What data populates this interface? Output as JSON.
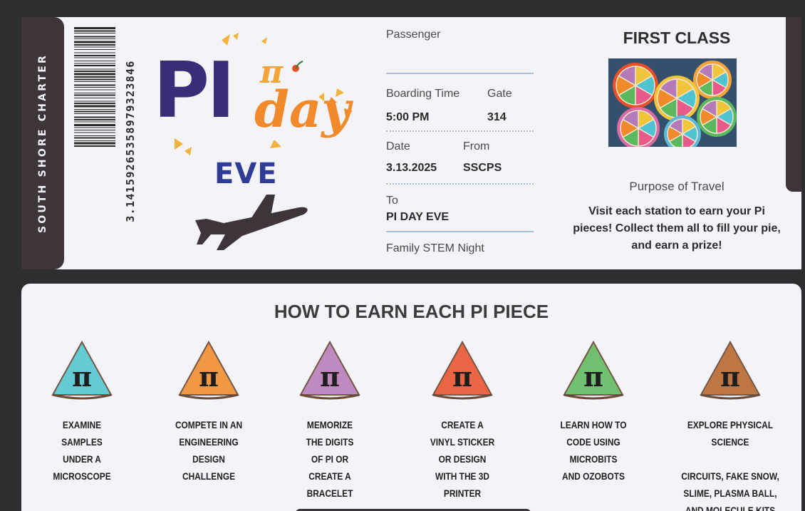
{
  "ticket": {
    "airline": "SOUTH SHORE CHARTER",
    "barcode_number": "3.14159265358979323846",
    "logo": {
      "pi": "PI",
      "pi_symbol": "π",
      "day": "day",
      "eve": "EVE"
    },
    "fields": {
      "passenger_label": "Passenger",
      "boarding_time_label": "Boarding Time",
      "boarding_time": "5:00 PM",
      "gate_label": "Gate",
      "gate": "314",
      "date_label": "Date",
      "date": "3.13.2025",
      "from_label": "From",
      "from": "SSCPS",
      "to_label": "To",
      "to": "PI DAY EVE",
      "event": "Family STEM Night"
    },
    "class": "FIRST CLASS",
    "purpose_label": "Purpose of Travel",
    "purpose_text": "Visit each station to earn your Pi pieces! Collect them all to fill your pie, and earn a prize!"
  },
  "stations_panel": {
    "title": "HOW TO EARN EACH PI PIECE",
    "stations": [
      {
        "icon": "pi-piece-blue-icon",
        "color": "#4fc3cf",
        "text": "EXAMINE\nSAMPLES\nUNDER A\nMICROSCOPE"
      },
      {
        "icon": "pi-piece-orange-icon",
        "color": "#f08a2a",
        "text": "COMPETE IN AN\nENGINEERING\nDESIGN\nCHALLENGE"
      },
      {
        "icon": "pi-piece-purple-icon",
        "color": "#b57ab8",
        "text": "MEMORIZE\nTHE DIGITS\nOF PI OR\nCREATE A\nBRACELET"
      },
      {
        "icon": "pi-piece-red-icon",
        "color": "#e8502a",
        "text": "CREATE A\nVINYL STICKER\nOR  DESIGN\nWITH THE 3D\nPRINTER"
      },
      {
        "icon": "pi-piece-green-icon",
        "color": "#5cb85c",
        "text": "LEARN HOW TO\nCODE USING\nMICROBITS\nAND OZOBOTS"
      },
      {
        "icon": "pi-piece-brown-icon",
        "color": "#b5652a",
        "text": "EXPLORE PHYSICAL\nSCIENCE\n\nCIRCUITS, FAKE SNOW,\nSLIME, PLASMA BALL,\nAND MOLECULE KITS"
      }
    ]
  }
}
